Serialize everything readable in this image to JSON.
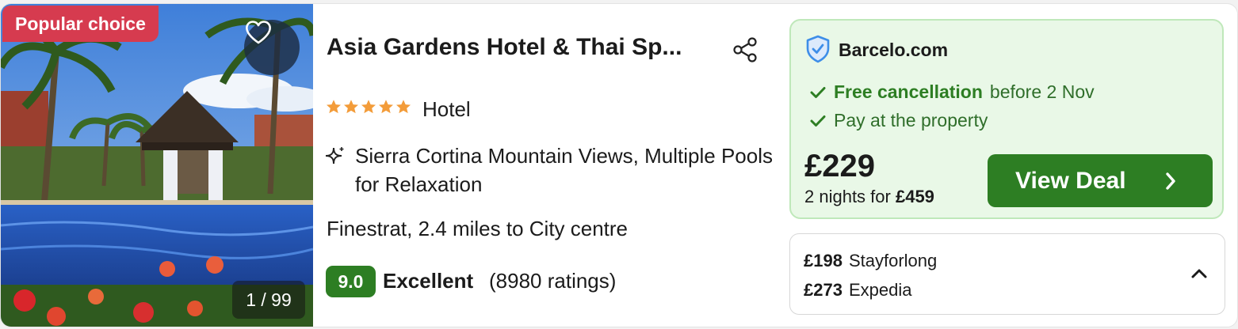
{
  "listing": {
    "badge": "Popular choice",
    "image_counter": "1 / 99",
    "title": "Asia Gardens Hotel & Thai Sp...",
    "star_count": 5,
    "type": "Hotel",
    "amenities": "Sierra Cortina Mountain Views, Multiple Pools for Relaxation",
    "location": "Finestrat, 2.4 miles to City centre",
    "score": "9.0",
    "rating_word": "Excellent",
    "rating_count": "(8980 ratings)",
    "icons": {
      "favorite": "heart-icon",
      "share": "share-icon",
      "amenity": "sparkle-icon",
      "star": "star-icon"
    }
  },
  "deal": {
    "provider": "Barcelo.com",
    "free_cancellation": "Free cancellation",
    "cancellation_until": "before 2 Nov",
    "pay_at_property": "Pay at the property",
    "price": "£229",
    "nights_label": "2 nights for",
    "total": "£459",
    "cta": "View Deal",
    "icons": {
      "provider": "shield-check-icon",
      "check": "check-icon",
      "cta": "chevron-right-icon"
    }
  },
  "other_prices": [
    {
      "price": "£198",
      "provider": "Stayforlong"
    },
    {
      "price": "£273",
      "provider": "Expedia"
    }
  ],
  "colors": {
    "badge": "#d63b4f",
    "accent_green": "#2d7e23",
    "deal_background": "#e9f8e7",
    "star": "#f39c3a",
    "shield": "#3e8ee8"
  }
}
